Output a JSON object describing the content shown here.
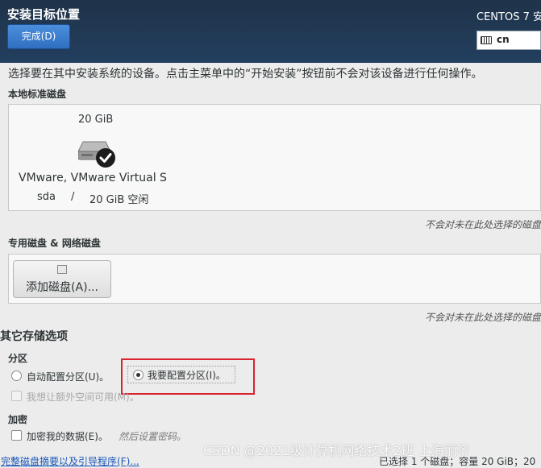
{
  "header": {
    "title": "安装目标位置",
    "done_button": "完成(D)",
    "os_label": "CENTOS 7 安",
    "keyboard_layout": "cn",
    "keyboard_icon": "keyboard-icon"
  },
  "instruction": "选择要在其中安装系统的设备。点击主菜单中的“开始安装”按钮前不会对该设备进行任何操作。",
  "local_disks": {
    "label": "本地标准磁盘",
    "disk": {
      "size": "20 GiB",
      "name": "VMware, VMware Virtual S",
      "device": "sda",
      "separator": "/",
      "free": "20 GiB 空闲",
      "icon": "hard-disk-icon",
      "selected": true
    },
    "note": "不会对未在此处选择的磁盘"
  },
  "specialized_disks": {
    "label": "专用磁盘 & 网络磁盘",
    "add_button": "添加磁盘(A)...",
    "note": "不会对未在此处选择的磁盘"
  },
  "other_options": {
    "title": "其它存储选项",
    "partitioning": {
      "label": "分区",
      "auto": "自动配置分区(U)。",
      "manual": "我要配置分区(I)。",
      "selected": "manual",
      "extra_space": "我想让额外空间可用(M)。"
    },
    "encryption": {
      "label": "加密",
      "encrypt": "加密我的数据(E)。",
      "hint": "然后设置密码。"
    }
  },
  "footer": {
    "summary_link": "完整磁盘摘要以及引导程序(F)...",
    "status": "已选择 1 个磁盘；容量 20 GiB；20"
  },
  "watermark": "CSDN @2021级计算机网络技术2班 上海丽齐",
  "colors": {
    "header_bg": "#1f3349",
    "done_button": "#3a7bd5",
    "highlight": "#d9232d",
    "link": "#1a57b8"
  }
}
